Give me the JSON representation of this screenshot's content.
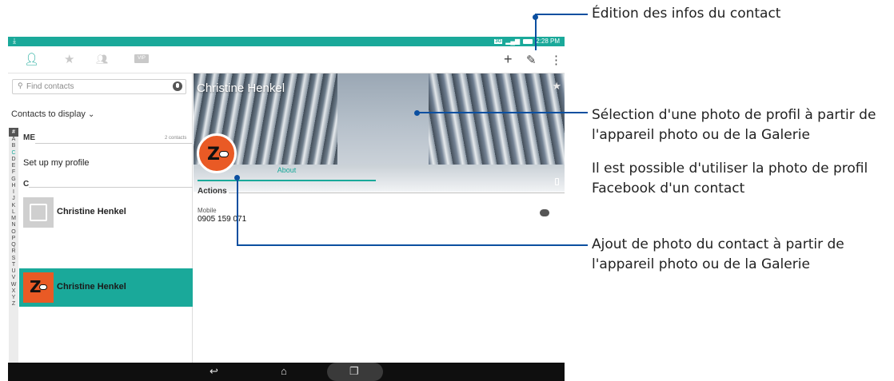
{
  "status_bar": {
    "time": "2:28 PM",
    "network": "3G",
    "download_icon": "download-icon"
  },
  "toolbar": {
    "tabs": [
      "contacts-icon",
      "favorites-icon",
      "groups-icon",
      "vip-icon"
    ],
    "vip_label": "VIP",
    "actions": [
      "add-icon",
      "edit-icon",
      "overflow-menu-icon"
    ]
  },
  "left_pane": {
    "search_placeholder": "Find contacts",
    "contacts_to_display": "Contacts to display",
    "alphabet": [
      "#",
      "A",
      "B",
      "C",
      "D",
      "E",
      "F",
      "G",
      "H",
      "I",
      "J",
      "K",
      "L",
      "M",
      "N",
      "O",
      "P",
      "Q",
      "R",
      "S",
      "T",
      "U",
      "V",
      "W",
      "X",
      "Y",
      "Z"
    ],
    "sections": [
      {
        "header": "ME",
        "note": "2 contacts"
      },
      {
        "header": "C",
        "note": ""
      }
    ],
    "setup_profile": "Set up my profile",
    "contacts": [
      {
        "name": "Christine Henkel",
        "selected": false
      },
      {
        "name": "Christine Henkel",
        "selected": true
      }
    ]
  },
  "detail": {
    "contact_name": "Christine Henkel",
    "tab_about": "About",
    "actions_header": "Actions",
    "phone_type": "Mobile",
    "phone_number": "0905 159 071"
  },
  "callouts": {
    "edit": "Édition des infos du contact",
    "cover_line1": "Sélection d'une photo de profil à partir de",
    "cover_line2": "l'appareil photo ou de la Galerie",
    "facebook_line1": "Il est possible d'utiliser la photo de profil",
    "facebook_line2": "Facebook d'un contact",
    "avatar_line1": "Ajout de photo du contact à partir de",
    "avatar_line2": "l'appareil photo ou de la Galerie"
  },
  "colors": {
    "accent": "#1aa99a",
    "callout": "#0b4fa0",
    "avatar": "#e95a25"
  }
}
